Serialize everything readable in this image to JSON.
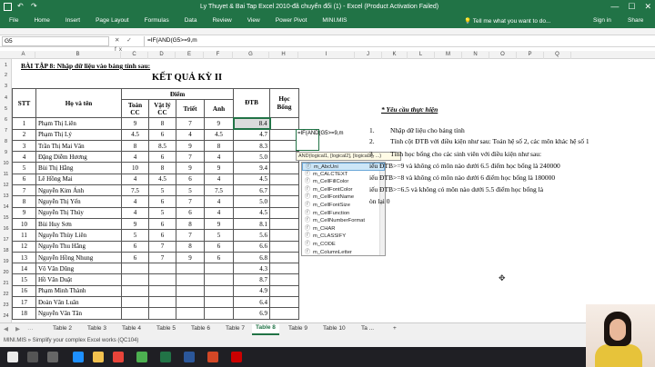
{
  "window": {
    "title": "Ly Thuyet & Bai Tap Excel 2010-đã chuyển đổi (1) - Excel (Product Activation Failed)",
    "min": "—",
    "max": "☐",
    "close": "✕"
  },
  "ribbon": {
    "tabs": [
      "File",
      "Home",
      "Insert",
      "Page Layout",
      "Formulas",
      "Data",
      "Review",
      "View",
      "Power Pivot",
      "MINI.MIS"
    ],
    "tell_me": "Tell me what you want to do...",
    "sign_in": "Sign in",
    "share": "Share"
  },
  "formula_bar": {
    "name_box": "G5",
    "fx_icons": "✕ ✓ fx",
    "formula": "=IF(AND(G5>=9,m"
  },
  "columns": [
    "A",
    "B",
    "C",
    "D",
    "E",
    "F",
    "G",
    "H",
    "I",
    "J",
    "K",
    "L",
    "M",
    "N",
    "O",
    "P",
    "Q"
  ],
  "rows": [
    "1",
    "2",
    "3",
    "4",
    "5",
    "6",
    "7",
    "8",
    "9",
    "10",
    "11",
    "12",
    "13",
    "14",
    "15",
    "16",
    "17",
    "18",
    "19",
    "20",
    "21",
    "22",
    "23",
    "24"
  ],
  "sheet": {
    "heading": "BÀI TẬP 8: Nhập dữ liệu vào bảng tính sau:",
    "result_title": "KẾT QUẢ KỲ II",
    "headers": {
      "stt": "STT",
      "name": "Họ và tên",
      "diem": "Điểm",
      "toan": "Toán CC",
      "vatly": "Vật lý CC",
      "triet": "Triết",
      "anh": "Anh",
      "dtb": "ĐTB",
      "hocbong": "Học Bổng"
    },
    "students": [
      {
        "stt": "1",
        "name": "Phạm Thị Liên",
        "toan": "9",
        "vatly": "8",
        "triet": "7",
        "anh": "9",
        "dtb": "8.4"
      },
      {
        "stt": "2",
        "name": "Phạm Thị Lý",
        "toan": "4.5",
        "vatly": "6",
        "triet": "4",
        "anh": "4.5",
        "dtb": "4.7"
      },
      {
        "stt": "3",
        "name": "Trần Thị Mai Vân",
        "toan": "8",
        "vatly": "8.5",
        "triet": "9",
        "anh": "8",
        "dtb": "8.3"
      },
      {
        "stt": "4",
        "name": "Đặng Diễm Hương",
        "toan": "4",
        "vatly": "6",
        "triet": "7",
        "anh": "4",
        "dtb": "5.0"
      },
      {
        "stt": "5",
        "name": "Bùi Thị Hằng",
        "toan": "10",
        "vatly": "8",
        "triet": "9",
        "anh": "9",
        "dtb": "9.4"
      },
      {
        "stt": "6",
        "name": "Lê Hồng Mai",
        "toan": "4",
        "vatly": "4.5",
        "triet": "6",
        "anh": "4",
        "dtb": "4.5"
      },
      {
        "stt": "7",
        "name": "Nguyễn Kim Ánh",
        "toan": "7.5",
        "vatly": "5",
        "triet": "5",
        "anh": "7.5",
        "dtb": "6.7"
      },
      {
        "stt": "8",
        "name": "Nguyễn Thị Yến",
        "toan": "4",
        "vatly": "6",
        "triet": "7",
        "anh": "4",
        "dtb": "5.0"
      },
      {
        "stt": "9",
        "name": "Nguyễn Thị Thúy",
        "toan": "4",
        "vatly": "5",
        "triet": "6",
        "anh": "4",
        "dtb": "4.5"
      },
      {
        "stt": "10",
        "name": "Bùi Huy Sơn",
        "toan": "9",
        "vatly": "6",
        "triet": "8",
        "anh": "9",
        "dtb": "8.1"
      },
      {
        "stt": "11",
        "name": "Nguyễn Thùy Liên",
        "toan": "5",
        "vatly": "6",
        "triet": "7",
        "anh": "5",
        "dtb": "5.6"
      },
      {
        "stt": "12",
        "name": "Nguyễn Thu Hằng",
        "toan": "6",
        "vatly": "7",
        "triet": "8",
        "anh": "6",
        "dtb": "6.6"
      },
      {
        "stt": "13",
        "name": "Nguyễn Hồng Nhung",
        "toan": "6",
        "vatly": "7",
        "triet": "9",
        "anh": "6",
        "dtb": "6.8"
      },
      {
        "stt": "14",
        "name": "Võ Văn Dũng",
        "toan": "",
        "vatly": "",
        "triet": "",
        "anh": "",
        "dtb": "4.3"
      },
      {
        "stt": "15",
        "name": "Hồ Văn Duật",
        "toan": "",
        "vatly": "",
        "triet": "",
        "anh": "",
        "dtb": "8.7"
      },
      {
        "stt": "16",
        "name": "Phạm Minh Thành",
        "toan": "",
        "vatly": "",
        "triet": "",
        "anh": "",
        "dtb": "4.9"
      },
      {
        "stt": "17",
        "name": "Đoàn Văn Luân",
        "toan": "",
        "vatly": "",
        "triet": "",
        "anh": "",
        "dtb": "6.4"
      },
      {
        "stt": "18",
        "name": "Nguyễn Văn Tân",
        "toan": "",
        "vatly": "",
        "triet": "",
        "anh": "",
        "dtb": "6.9"
      }
    ],
    "edit_cell": "=IF(AND(G5>=9,m",
    "tooltip": "AND(logical1, [logical2], [logical3], ...)",
    "autocomplete": [
      "m_AbcUni",
      "m_CALCTEXT",
      "m_CellFillColor",
      "m_CellFontColor",
      "m_CellFontName",
      "m_CellFontSize",
      "m_CellFunction",
      "m_CellNumberFormat",
      "m_CHAR",
      "m_CLASSIFY",
      "m_CODE",
      "m_ColumnLetter"
    ],
    "requirements": {
      "title": "* Yêu cầu thực hiện",
      "l1n": "1.",
      "l1": "Nhập dữ liệu cho bảng tính",
      "l2n": "2.",
      "l2": "Tính cột ĐTB với điều kiện như sau: Toán hệ số 2, các môn khác hệ số 1",
      "l3n": "3.",
      "l3": "Tính học bổng cho các sinh viên với điều kiện như sau:",
      "l4": "iếu ĐTB>=9 và không có môn nào dưới 6.5 điểm học bổng là 240000",
      "l5": "iếu ĐTB>=8 và không có môn nào dưới 6 điểm học bổng là 180000",
      "l6": "iếu ĐTB>=6.5 và không có môn nào dưới 5.5 điểm học bổng là",
      "l7": "òn lại 0"
    }
  },
  "sheet_tabs": {
    "nav": [
      "◀",
      "▶",
      "…"
    ],
    "tabs": [
      "Table 2",
      "Table 3",
      "Table 4",
      "Table 5",
      "Table 6",
      "Table 7",
      "Table 8",
      "Table 9",
      "Table 10",
      "Ta ..."
    ],
    "active": "Table 8",
    "add": "+"
  },
  "status": {
    "message": "MINI.MIS » Simplify your complex Excel works (QC104)"
  }
}
